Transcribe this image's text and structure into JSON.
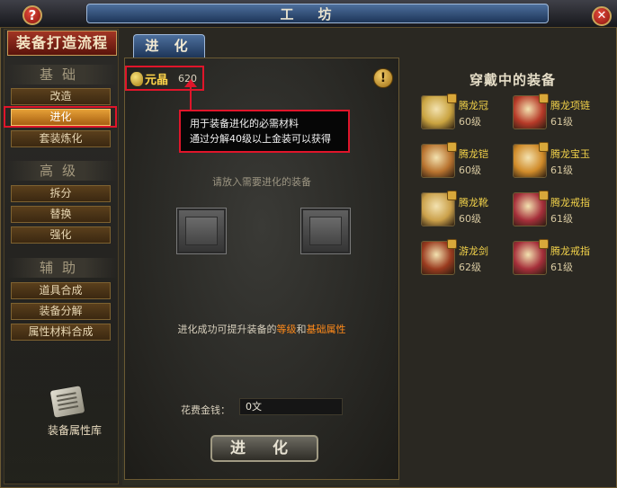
{
  "window": {
    "title": "工　坊",
    "help_label": "?",
    "close_label": "✕"
  },
  "sidebar": {
    "header": "装备打造流程",
    "sections": [
      {
        "title": "基础",
        "items": [
          "改造",
          "进化",
          "套装炼化"
        ]
      },
      {
        "title": "高级",
        "items": [
          "拆分",
          "替换",
          "强化"
        ]
      },
      {
        "title": "辅助",
        "items": [
          "道具合成",
          "装备分解",
          "属性材料合成"
        ]
      }
    ],
    "library_label": "装备属性库"
  },
  "main": {
    "tab_label": "进 化",
    "crystal_label": "元晶",
    "crystal_value": "620",
    "warn_label": "!",
    "tooltip_line1": "用于装备进化的必需材料",
    "tooltip_line2": "通过分解40级以上金装可以获得",
    "place_hint": "请放入需要进化的装备",
    "success_prefix": "进化成功可提升装备的",
    "success_hl1": "等级",
    "success_mid": "和",
    "success_hl2": "基础属性",
    "cost_label": "花费金钱：",
    "cost_value": "0文",
    "evolve_button": "进 化"
  },
  "equipped": {
    "title": "穿戴中的装备",
    "items": [
      {
        "name": "腾龙冠",
        "level": "60级",
        "icon": "helmet-icon",
        "color": "#c9a340"
      },
      {
        "name": "腾龙项链",
        "level": "61级",
        "icon": "necklace-icon",
        "color": "#b63a28"
      },
      {
        "name": "腾龙铠",
        "level": "60级",
        "icon": "armor-icon",
        "color": "#b8732f"
      },
      {
        "name": "腾龙宝玉",
        "level": "61级",
        "icon": "jade-icon",
        "color": "#d08b2a"
      },
      {
        "name": "腾龙靴",
        "level": "60级",
        "icon": "boots-icon",
        "color": "#caa04a"
      },
      {
        "name": "腾龙戒指",
        "level": "61级",
        "icon": "ring-icon",
        "color": "#a52f3a"
      },
      {
        "name": "游龙剑",
        "level": "62级",
        "icon": "sword-icon",
        "color": "#9a3b1f"
      },
      {
        "name": "腾龙戒指",
        "level": "61级",
        "icon": "ring-icon",
        "color": "#a52f3a"
      }
    ]
  }
}
